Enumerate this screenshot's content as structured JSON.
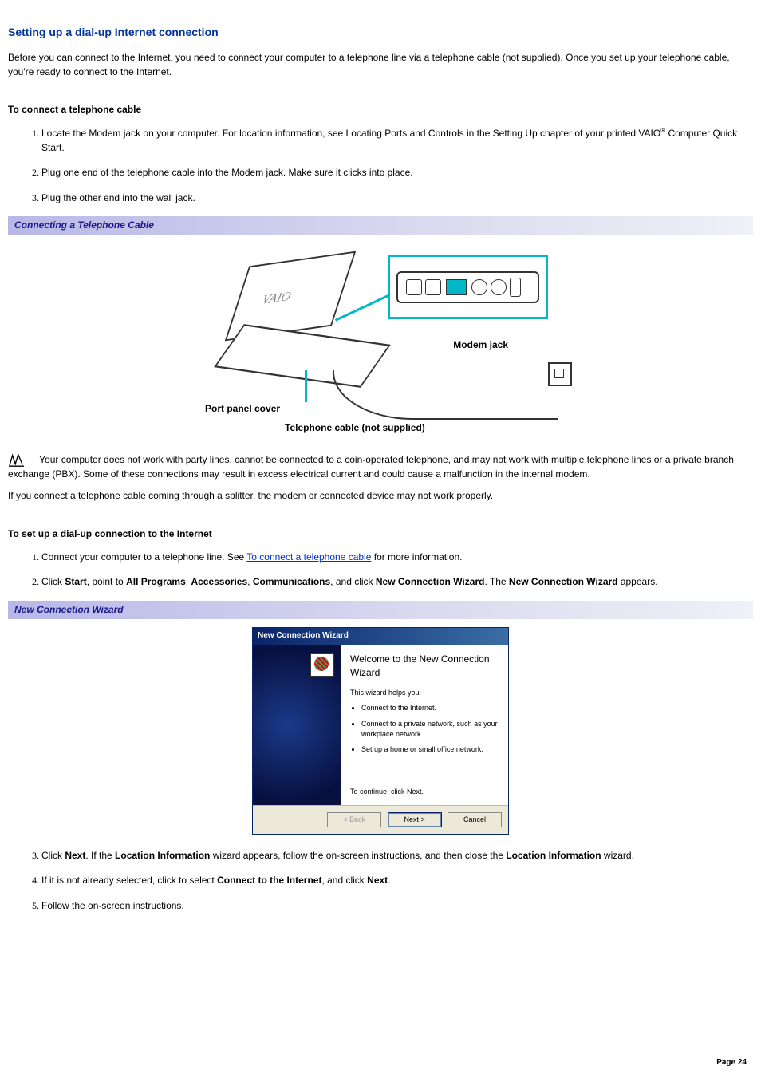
{
  "title": "Setting up a dial-up Internet connection",
  "intro": "Before you can connect to the Internet, you need to connect your computer to a telephone line via a telephone cable (not supplied). Once you set up your telephone cable, you're ready to connect to the Internet.",
  "section1_heading": "To connect a telephone cable",
  "steps1": {
    "s1a": "Locate the Modem jack on your computer. For location information, see Locating Ports and Controls in the Setting Up chapter of your printed VAIO",
    "s1b": " Computer Quick Start.",
    "s2": "Plug one end of the telephone cable into the Modem jack. Make sure it clicks into place.",
    "s3": "Plug the other end into the wall jack."
  },
  "figure1_caption": "Connecting a Telephone Cable",
  "figure1_labels": {
    "modem": "Modem jack",
    "portcover": "Port panel cover",
    "cable": "Telephone cable (not supplied)"
  },
  "note_text": "Your computer does not work with party lines, cannot be connected to a coin-operated telephone, and may not work with multiple telephone lines or a private branch exchange (PBX). Some of these connections may result in excess electrical current and could cause a malfunction in the internal modem.",
  "note2": "If you connect a telephone cable coming through a splitter, the modem or connected device may not work properly.",
  "section2_heading": "To set up a dial-up connection to the Internet",
  "steps2": {
    "s1a": "Connect your computer to a telephone line. See ",
    "s1link": "To connect a telephone cable",
    "s1b": " for more information.",
    "s2a": "Click ",
    "s2b": "Start",
    "s2c": ", point to ",
    "s2d": "All Programs",
    "s2e": ", ",
    "s2f": "Accessories",
    "s2g": ", ",
    "s2h": "Communications",
    "s2i": ", and click ",
    "s2j": "New Connection Wizard",
    "s2k": ". The ",
    "s2l": "New Connection Wizard",
    "s2m": " appears.",
    "s3a": "Click ",
    "s3b": "Next",
    "s3c": ". If the ",
    "s3d": "Location Information",
    "s3e": " wizard appears, follow the on-screen instructions, and then close the ",
    "s3f": "Location Information",
    "s3g": " wizard.",
    "s4a": "If it is not already selected, click to select ",
    "s4b": "Connect to the Internet",
    "s4c": ", and click ",
    "s4d": "Next",
    "s4e": ".",
    "s5": "Follow the on-screen instructions."
  },
  "figure2_caption": "New Connection Wizard",
  "wizard": {
    "titlebar": "New Connection Wizard",
    "heading": "Welcome to the New Connection Wizard",
    "helps": "This wizard helps you:",
    "b1": "Connect to the Internet.",
    "b2": "Connect to a private network, such as your workplace network.",
    "b3": "Set up a home or small office network.",
    "continue": "To continue, click Next.",
    "back": "< Back",
    "next": "Next >",
    "cancel": "Cancel"
  },
  "registered": "®",
  "page_number": "Page 24"
}
